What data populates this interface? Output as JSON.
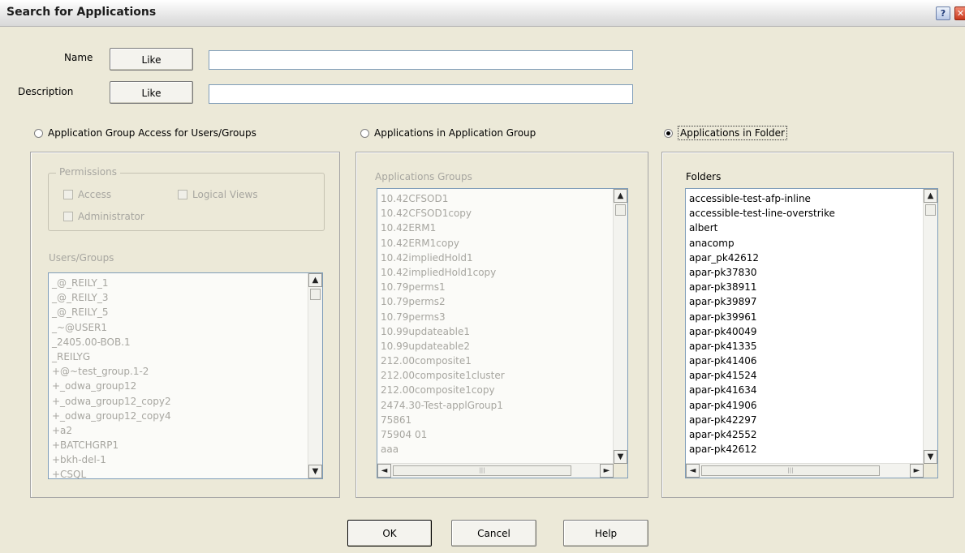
{
  "window": {
    "title": "Search for Applications",
    "help_glyph": "?",
    "close_glyph": "✕"
  },
  "fields": {
    "name": {
      "label": "Name",
      "operator": "Like",
      "value": ""
    },
    "description": {
      "label": "Description",
      "operator": "Like",
      "value": ""
    }
  },
  "options": {
    "group_access": {
      "label": "Application Group Access for Users/Groups",
      "selected": false
    },
    "apps_in_group": {
      "label": "Applications in Application Group",
      "selected": false
    },
    "apps_in_folder": {
      "label": "Applications in Folder",
      "selected": true
    }
  },
  "permissions": {
    "legend": "Permissions",
    "access": "Access",
    "logical_views": "Logical Views",
    "administrator": "Administrator"
  },
  "users_groups": {
    "label": "Users/Groups",
    "items": [
      "_@_REILY_1",
      "_@_REILY_3",
      "_@_REILY_5",
      "_~@USER1",
      "_2405.00-BOB.1",
      "_REILYG",
      "+@~test_group.1-2",
      "+_odwa_group12",
      "+_odwa_group12_copy2",
      "+_odwa_group12_copy4",
      "+a2",
      "+BATCHGRP1",
      "+bkh-del-1",
      "+CSQL"
    ]
  },
  "application_groups": {
    "label": "Applications Groups",
    "items": [
      "10.42CFSOD1",
      "10.42CFSOD1copy",
      "10.42ERM1",
      "10.42ERM1copy",
      "10.42impliedHold1",
      "10.42impliedHold1copy",
      "10.79perms1",
      "10.79perms2",
      "10.79perms3",
      "10.99updateable1",
      "10.99updateable2",
      "212.00composite1",
      "212.00composite1cluster",
      "212.00composite1copy",
      "2474.30-Test-applGroup1",
      "75861",
      "75904 01",
      "aaa"
    ]
  },
  "folders": {
    "label": "Folders",
    "items": [
      "accessible-test-afp-inline",
      "accessible-test-line-overstrike",
      "albert",
      "anacomp",
      "apar_pk42612",
      "apar-pk37830",
      "apar-pk38911",
      "apar-pk39897",
      "apar-pk39961",
      "apar-pk40049",
      "apar-pk41335",
      "apar-pk41406",
      "apar-pk41524",
      "apar-pk41634",
      "apar-pk41906",
      "apar-pk42297",
      "apar-pk42552",
      "apar-pk42612"
    ]
  },
  "scroll": {
    "up": "▲",
    "down": "▼",
    "left": "◄",
    "right": "►",
    "grip": "|||"
  },
  "buttons": {
    "ok": "OK",
    "cancel": "Cancel",
    "help": "Help"
  }
}
